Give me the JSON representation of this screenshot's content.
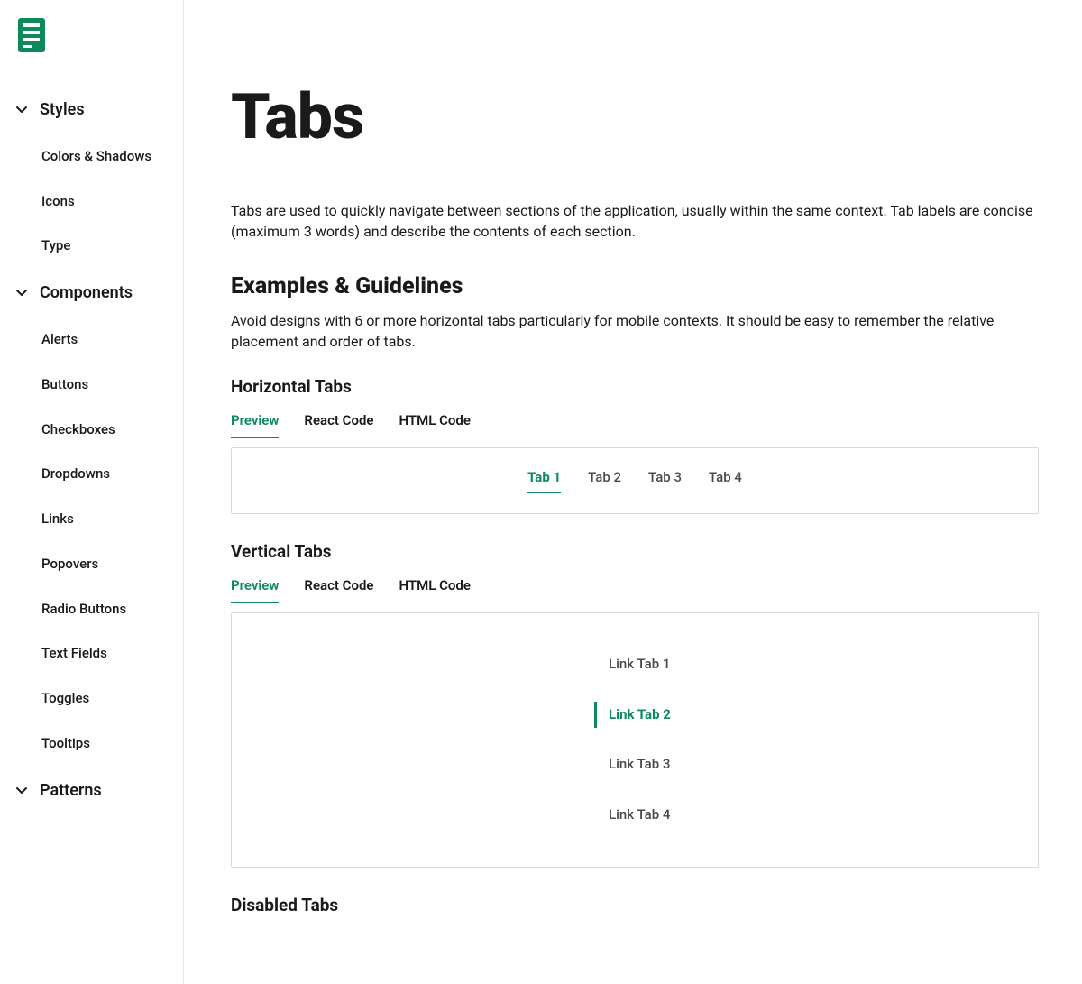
{
  "accent": "#0d8a5c",
  "sidebar": {
    "sections": [
      {
        "label": "Styles",
        "expanded": true,
        "items": [
          {
            "label": "Colors & Shadows"
          },
          {
            "label": "Icons"
          },
          {
            "label": "Type"
          }
        ]
      },
      {
        "label": "Components",
        "expanded": true,
        "items": [
          {
            "label": "Alerts"
          },
          {
            "label": "Buttons"
          },
          {
            "label": "Checkboxes"
          },
          {
            "label": "Dropdowns"
          },
          {
            "label": "Links"
          },
          {
            "label": "Popovers"
          },
          {
            "label": "Radio Buttons"
          },
          {
            "label": "Text Fields"
          },
          {
            "label": "Toggles"
          },
          {
            "label": "Tooltips"
          }
        ]
      },
      {
        "label": "Patterns",
        "expanded": true,
        "items": []
      }
    ]
  },
  "page": {
    "title": "Tabs",
    "intro": "Tabs are used to quickly navigate between sections of the application, usually within the same context. Tab labels are concise (maximum 3 words) and describe the contents of each section.",
    "guidelines_heading": "Examples & Guidelines",
    "guidelines_body": "Avoid designs with 6 or more horizontal tabs particularly for mobile contexts. It should be easy to remember the relative placement and order of tabs.",
    "code_tabs": {
      "preview": "Preview",
      "react": "React Code",
      "html": "HTML Code"
    },
    "horizontal": {
      "heading": "Horizontal Tabs",
      "tabs": [
        {
          "label": "Tab 1",
          "active": true
        },
        {
          "label": "Tab 2",
          "active": false
        },
        {
          "label": "Tab 3",
          "active": false
        },
        {
          "label": "Tab 4",
          "active": false
        }
      ]
    },
    "vertical": {
      "heading": "Vertical Tabs",
      "tabs": [
        {
          "label": "Link Tab 1",
          "active": false
        },
        {
          "label": "Link Tab 2",
          "active": true
        },
        {
          "label": "Link Tab 3",
          "active": false
        },
        {
          "label": "Link Tab 4",
          "active": false
        }
      ]
    },
    "disabled": {
      "heading": "Disabled Tabs"
    }
  }
}
